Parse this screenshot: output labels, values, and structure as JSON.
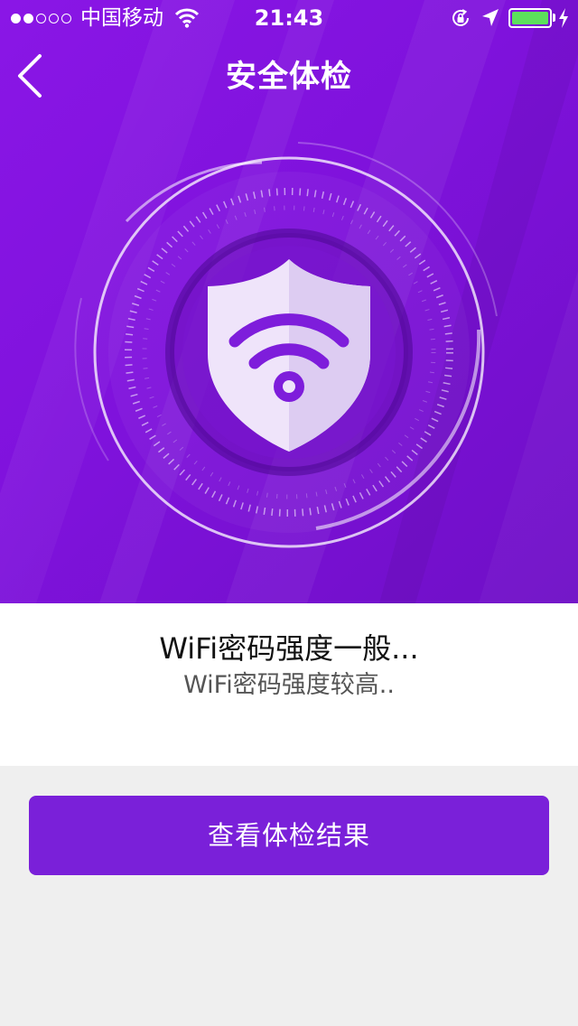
{
  "status_bar": {
    "carrier": "中国移动",
    "time": "21:43",
    "signal_bars": 2,
    "signal_total": 5,
    "battery_level": 1.0,
    "battery_color": "#5ce05c"
  },
  "nav": {
    "title": "安全体检",
    "back_icon": "chevron-left-icon"
  },
  "scanner": {
    "icon": "wifi-shield-icon"
  },
  "status": {
    "primary": "WiFi密码强度一般...",
    "secondary": "WiFi密码强度较高.."
  },
  "button": {
    "label": "查看体检结果"
  },
  "colors": {
    "header_purple": "#8016df",
    "button_purple": "#7a20d9",
    "page_bg": "#efefef"
  }
}
